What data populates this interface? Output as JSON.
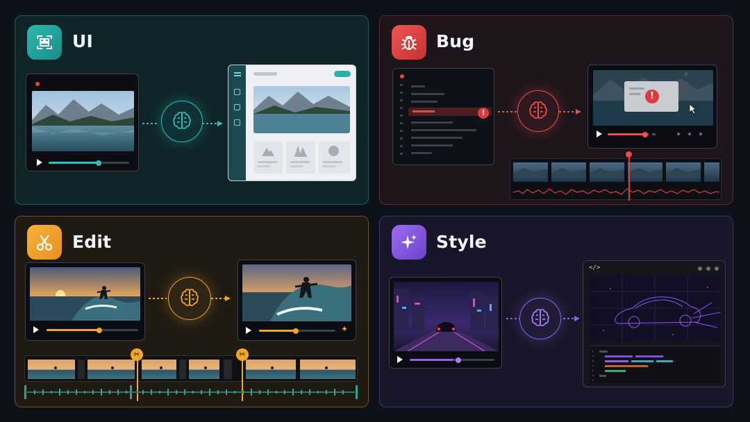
{
  "panels": {
    "ui": {
      "title": "UI",
      "accent": "#2cc0b4",
      "icon": "layout-grid-icon"
    },
    "bug": {
      "title": "Bug",
      "accent": "#ee4e4b",
      "icon": "bug-icon"
    },
    "edit": {
      "title": "Edit",
      "accent": "#f2a52d",
      "icon": "scissors-icon"
    },
    "style": {
      "title": "Style",
      "accent": "#8f62e8",
      "icon": "sparkle-icon"
    }
  },
  "style_panel": {
    "code_tag": "</>"
  },
  "progress": {
    "ui_player": 0.62,
    "bug_player": 0.36,
    "edit_left_player": 0.57,
    "edit_right_player": 0.49,
    "style_player": 0.52
  }
}
